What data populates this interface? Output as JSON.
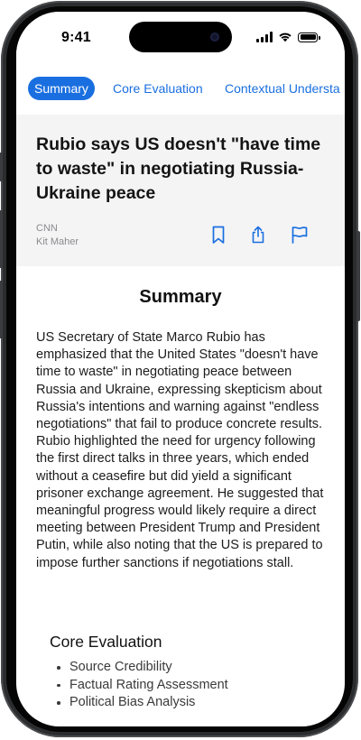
{
  "status_bar": {
    "time": "9:41",
    "icons": [
      "cellular-signal-icon",
      "wifi-icon",
      "battery-icon"
    ]
  },
  "tabs": [
    {
      "label": "Summary",
      "active": true
    },
    {
      "label": "Core Evaluation",
      "active": false
    },
    {
      "label": "Contextual Understa",
      "active": false
    }
  ],
  "article": {
    "headline": "Rubio says US doesn't \"have time to waste\" in negotiating Russia-Ukraine peace",
    "source": "CNN",
    "author": "Kit Maher",
    "actions": [
      "bookmark-icon",
      "share-icon",
      "flag-icon"
    ]
  },
  "summary": {
    "title": "Summary",
    "body": "US Secretary of State Marco Rubio has emphasized that the United States \"doesn't have time to waste\" in negotiating peace between Russia and Ukraine, expressing skepticism about Russia's intentions and warning against \"endless negotiations\" that fail to produce concrete results. Rubio highlighted the need for urgency following the first direct talks in three years, which ended without a ceasefire but did yield a significant prisoner exchange agreement. He suggested that meaningful progress would likely require a direct meeting between President Trump and President Putin, while also noting that the US is prepared to impose further sanctions if negotiations stall."
  },
  "core_evaluation": {
    "title": "Core Evaluation",
    "items": [
      "Source Credibility",
      "Factual Rating Assessment",
      "Political Bias Analysis"
    ]
  },
  "colors": {
    "accent": "#1a6fe0",
    "header_bg": "#f4f4f5",
    "frame": "#2b2c2e"
  }
}
